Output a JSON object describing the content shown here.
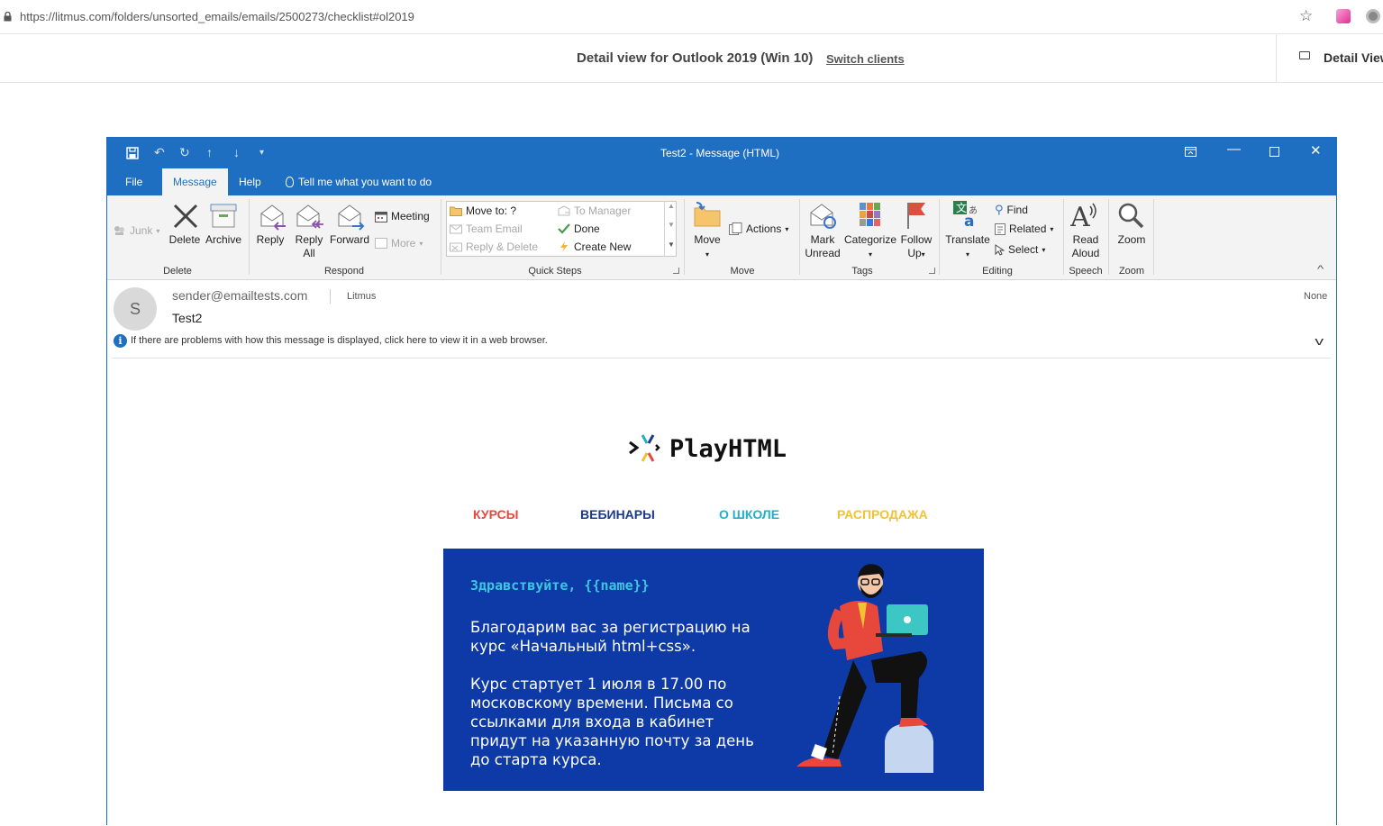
{
  "browser": {
    "url": "https://litmus.com/folders/unsorted_emails/emails/2500273/checklist#ol2019"
  },
  "litmus": {
    "title": "Detail view for Outlook 2019 (Win 10)",
    "switch_label": "Switch clients",
    "detail_view_label": "Detail View"
  },
  "outlook": {
    "window_title": "Test2  -  Message (HTML)",
    "tabs": [
      {
        "label": "File"
      },
      {
        "label": "Message"
      },
      {
        "label": "Help"
      },
      {
        "label": "Tell me what you want to do"
      }
    ],
    "ribbon": {
      "delete_group": {
        "junk": "Junk",
        "delete": "Delete",
        "archive": "Archive",
        "label": "Delete"
      },
      "respond_group": {
        "reply": "Reply",
        "reply_all": "Reply All",
        "forward": "Forward",
        "meeting": "Meeting",
        "more": "More",
        "label": "Respond"
      },
      "quick_steps": {
        "items": [
          "Move to: ?",
          "To Manager",
          "Team Email",
          "Done",
          "Reply & Delete",
          "Create New"
        ],
        "label": "Quick Steps"
      },
      "move_group": {
        "move": "Move",
        "actions": "Actions",
        "label": "Move"
      },
      "tags_group": {
        "mark_unread": "Mark Unread",
        "categorize": "Categorize",
        "follow_up": "Follow Up",
        "label": "Tags"
      },
      "editing_group": {
        "translate": "Translate",
        "find": "Find",
        "related": "Related",
        "select": "Select",
        "label": "Editing"
      },
      "speech_group": {
        "read_aloud": "Read Aloud",
        "label": "Speech"
      },
      "zoom_group": {
        "zoom": "Zoom",
        "label": "Zoom"
      }
    },
    "message": {
      "avatar_letter": "S",
      "sender": "sender@emailtests.com",
      "to": "Litmus",
      "category": "None",
      "subject": "Test2",
      "info": "If there are problems with how this message is displayed, click here to view it in a web browser."
    }
  },
  "email": {
    "brand": "PlayHTML",
    "nav": [
      {
        "label": "КУРСЫ",
        "color": "#e8483b"
      },
      {
        "label": "ВЕБИНАРЫ",
        "color": "#1a3a8c"
      },
      {
        "label": "О ШКОЛЕ",
        "color": "#1fb0c9"
      },
      {
        "label": "РАСПРОДАЖА",
        "color": "#f1c232"
      }
    ],
    "greeting": "Здравствуйте, {{name}}",
    "paragraph1": "Благодарим вас за регистрацию на курс «Начальный html+css».",
    "paragraph2": "Курс стартует 1 июля в 17.00 по московскому времени. Письма со ссылками для входа в кабинет придут на указанную почту за день до старта курса."
  }
}
